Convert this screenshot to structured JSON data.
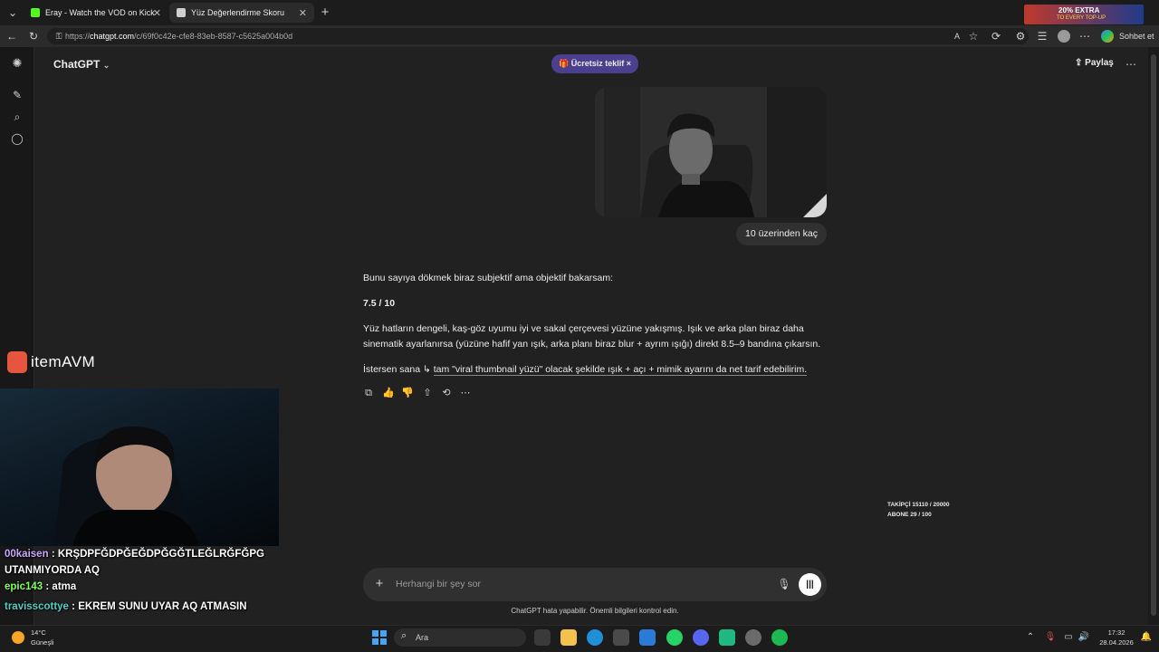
{
  "browser": {
    "tabs": [
      {
        "title": "Eray - Watch the VOD on Kick"
      },
      {
        "title": "Yüz Değerlendirme Skoru"
      }
    ],
    "url_prefix": "https://",
    "url_host": "chatgpt.com",
    "url_path": "/c/69f0c42e-cfe8-83eb-8587-c5625a004b0d",
    "profile_label": "Sohbet et",
    "ad_text": "20% EXTRA",
    "ad_subtext": "TO EVERY TOP-UP"
  },
  "chatgpt": {
    "model_label": "ChatGPT",
    "offer_label": "Ücretsiz teklif",
    "share_label": "Paylaş",
    "user_message": "10 üzerinden kaç",
    "assistant": {
      "p1": "Bunu sayıya dökmek biraz subjektif ama objektif bakarsam:",
      "score": "7.5 / 10",
      "p3": "Yüz hatların dengeli, kaş-göz uyumu iyi ve sakal çerçevesi yüzüne yakışmış. Işık ve arka plan biraz daha sinematik ayarlanırsa (yüzüne hafif yan ışık, arka planı biraz blur + ayrım ışığı) direkt 8.5–9 bandına çıkarsın.",
      "p4_prefix": "İstersen sana ↳",
      "p4_link": "tam \"viral thumbnail yüzü\" olacak şekilde ışık + açı + mimik ayarını da net tarif edebilirim."
    },
    "input_placeholder": "Herhangi bir şey sor",
    "disclaimer": "ChatGPT hata yapabilir. Önemli bilgileri kontrol edin."
  },
  "stream": {
    "brand": "itemAVM",
    "stats_followers": "TAKİPÇİ 15110 / 20000",
    "stats_subs": "ABONE 29 / 100",
    "chat": [
      {
        "user": "00kaisen",
        "user_color": "#c9a7ff",
        "text": ": KRŞDPFĞDPĞEĞDPĞGĞTLEĞLRĞFĞPG UTANMIYORDA AQ"
      },
      {
        "user": "epic143",
        "user_color": "#7dff5a",
        "text": ": atma"
      },
      {
        "user": "travisscottye",
        "user_color": "#4fd1c5",
        "text": ": EKREM SUNU UYAR AQ ATMASIN"
      }
    ]
  },
  "taskbar": {
    "weather_temp": "14°C",
    "weather_desc": "Güneşli",
    "search_label": "Ara",
    "time": "17:32",
    "date": "28.04.2026"
  },
  "colors": {
    "offer_bg": "#4b3f8f",
    "bubble": "#303030",
    "kick_green": "#53fc18"
  }
}
